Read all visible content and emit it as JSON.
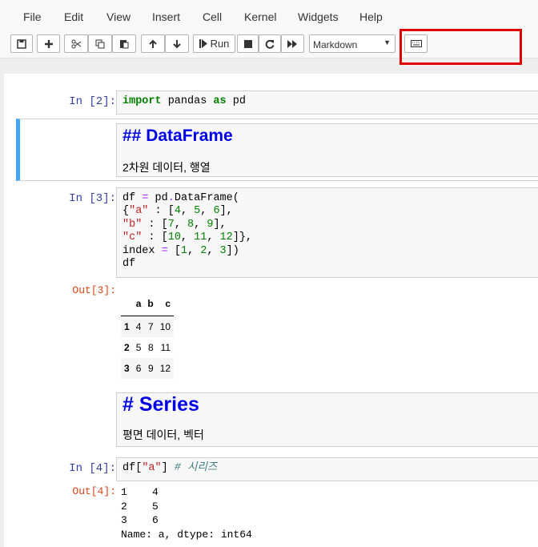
{
  "menu": [
    "File",
    "Edit",
    "View",
    "Insert",
    "Cell",
    "Kernel",
    "Widgets",
    "Help"
  ],
  "toolbar": {
    "run_label": "Run",
    "cell_type": "Markdown",
    "icons": [
      "save-icon",
      "plus-icon",
      "cut-icon",
      "copy-icon",
      "paste-icon",
      "move-up-icon",
      "move-down-icon",
      "run-icon",
      "stop-icon",
      "restart-icon",
      "fast-forward-icon",
      "keyboard-icon"
    ]
  },
  "colors": {
    "highlight": "#e00000",
    "selected_cell_bar": "#42a5f5",
    "heading": "#0000e6",
    "in_prompt": "#303f9f",
    "out_prompt": "#d84315"
  },
  "cells": {
    "c1": {
      "prompt": "In [2]:"
    },
    "c2": {
      "heading": "## DataFrame",
      "text": "2차원 데이터, 행열"
    },
    "c3": {
      "prompt": "In [3]:",
      "out_prompt": "Out[3]:"
    },
    "c4": {
      "heading": "# Series",
      "text": "평면 데이터, 벡터"
    },
    "c5": {
      "prompt": "In [4]:",
      "out_prompt": "Out[4]:"
    }
  },
  "dataframe": {
    "columns": [
      "a",
      "b",
      "c"
    ],
    "rows": [
      {
        "index": "1",
        "values": [
          "4",
          "7",
          "10"
        ]
      },
      {
        "index": "2",
        "values": [
          "5",
          "8",
          "11"
        ]
      },
      {
        "index": "3",
        "values": [
          "6",
          "9",
          "12"
        ]
      }
    ]
  },
  "series_output": [
    "1    4",
    "2    5",
    "3    6",
    "Name: a, dtype: int64"
  ]
}
